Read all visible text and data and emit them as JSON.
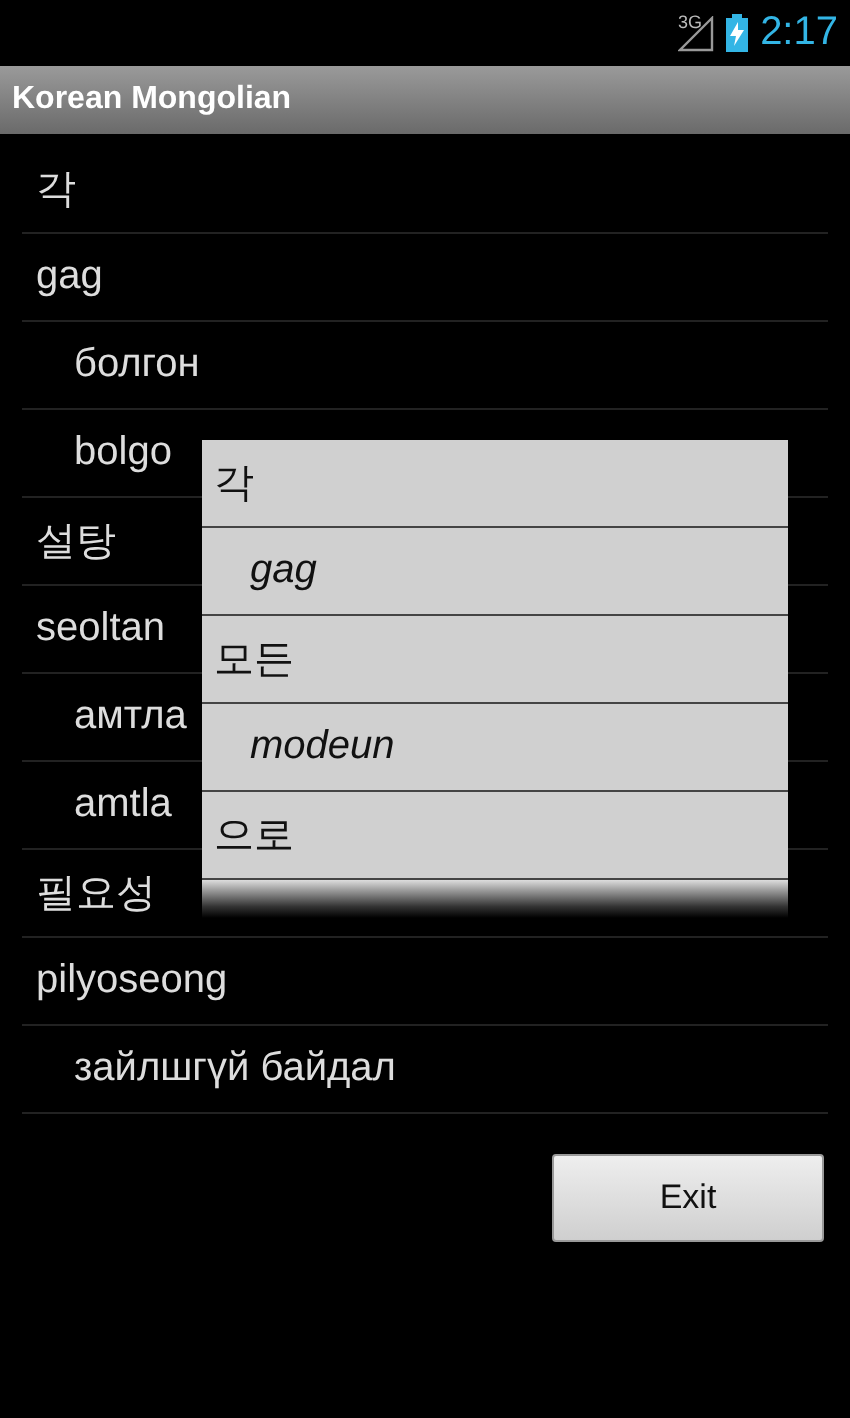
{
  "status_bar": {
    "network": "3G",
    "time": "2:17"
  },
  "title_bar": {
    "title": "Korean Mongolian"
  },
  "list": [
    {
      "kind": "korean",
      "text": "각"
    },
    {
      "kind": "roman",
      "text": "gag"
    },
    {
      "kind": "mongolian",
      "text": "болгон"
    },
    {
      "kind": "mongolian",
      "text": "bolgo"
    },
    {
      "kind": "korean",
      "text": "설탕"
    },
    {
      "kind": "roman",
      "text": "seoltan"
    },
    {
      "kind": "mongolian",
      "text": "амтла"
    },
    {
      "kind": "mongolian",
      "text": "amtla"
    },
    {
      "kind": "korean",
      "text": "필요성"
    },
    {
      "kind": "roman",
      "text": "pilyoseong"
    },
    {
      "kind": "mongolian",
      "text": "зайлшгүй байдал"
    }
  ],
  "popup": {
    "items": [
      {
        "kind": "word",
        "text": "각"
      },
      {
        "kind": "romanization",
        "text": "gag"
      },
      {
        "kind": "word",
        "text": "모든"
      },
      {
        "kind": "romanization",
        "text": "modeun"
      },
      {
        "kind": "word",
        "text": "으로"
      }
    ]
  },
  "buttons": [
    {
      "label": "Exit"
    }
  ]
}
